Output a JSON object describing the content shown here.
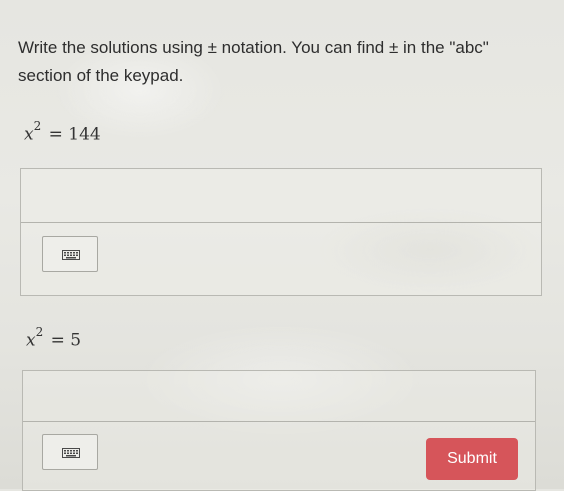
{
  "instruction": {
    "line1": "Write the solutions using ± notation. You can find ± in the \"abc\"",
    "line2": "section of the keypad."
  },
  "problems": [
    {
      "variable": "x",
      "exponent": "2",
      "rhs": "= 144"
    },
    {
      "variable": "x",
      "exponent": "2",
      "rhs": "= 5"
    }
  ],
  "icons": {
    "keypad": "keyboard-icon"
  },
  "submit": {
    "label": "Submit"
  },
  "colors": {
    "submit_bg": "#d6555a",
    "submit_text": "#ffffff"
  }
}
